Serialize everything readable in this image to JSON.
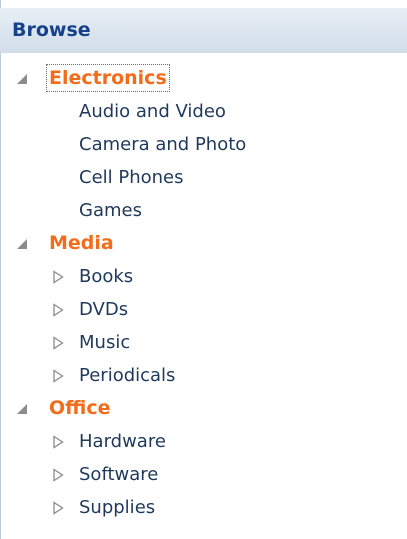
{
  "header": {
    "title": "Browse"
  },
  "colors": {
    "header_text": "#15428b",
    "category_text": "#f26c1b",
    "item_text": "#1e395b",
    "expanded_arrow": "#8c8c8c",
    "collapsed_arrow": "#8c8c8c"
  },
  "icons": {
    "expanded": "expanded-triangle-icon",
    "collapsed": "collapsed-triangle-icon"
  },
  "tree": {
    "categories": [
      {
        "label": "Electronics",
        "expanded": true,
        "focused": true,
        "children": [
          {
            "label": "Audio and Video",
            "expandable": false
          },
          {
            "label": "Camera and Photo",
            "expandable": false
          },
          {
            "label": "Cell Phones",
            "expandable": false
          },
          {
            "label": "Games",
            "expandable": false
          }
        ]
      },
      {
        "label": "Media",
        "expanded": true,
        "focused": false,
        "children": [
          {
            "label": "Books",
            "expandable": true
          },
          {
            "label": "DVDs",
            "expandable": true
          },
          {
            "label": "Music",
            "expandable": true
          },
          {
            "label": "Periodicals",
            "expandable": true
          }
        ]
      },
      {
        "label": "Office",
        "expanded": true,
        "focused": false,
        "children": [
          {
            "label": "Hardware",
            "expandable": true
          },
          {
            "label": "Software",
            "expandable": true
          },
          {
            "label": "Supplies",
            "expandable": true
          }
        ]
      }
    ]
  }
}
